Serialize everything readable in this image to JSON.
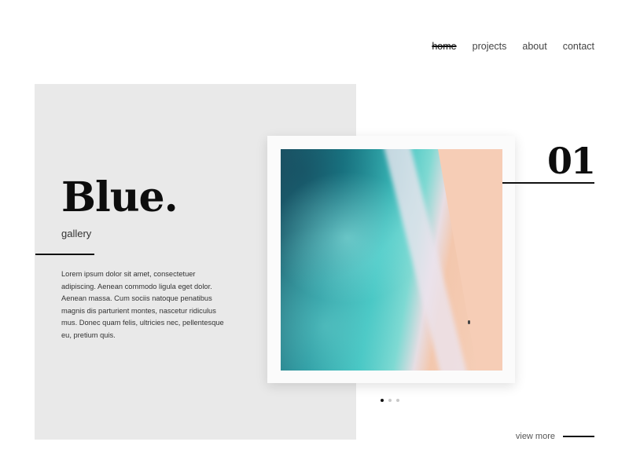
{
  "nav": {
    "items": [
      {
        "label": "home",
        "active": true
      },
      {
        "label": "projects",
        "active": false
      },
      {
        "label": "about",
        "active": false
      },
      {
        "label": "contact",
        "active": false
      }
    ]
  },
  "hero": {
    "title": "Blue.",
    "subtitle": "gallery",
    "description": "Lorem ipsum dolor sit amet, consectetuer adipiscing. Aenean commodo ligula eget dolor. Aenean massa. Cum sociis natoque penatibus magnis dis parturient montes, nascetur ridiculus mus. Donec quam felis, ultricies nec, pellentesque eu, pretium quis."
  },
  "slide": {
    "number": "01",
    "image_alt": "aerial view of turquoise ocean waves meeting a pink sand beach",
    "current": 1,
    "total": 3
  },
  "view_more": {
    "label": "view more"
  }
}
